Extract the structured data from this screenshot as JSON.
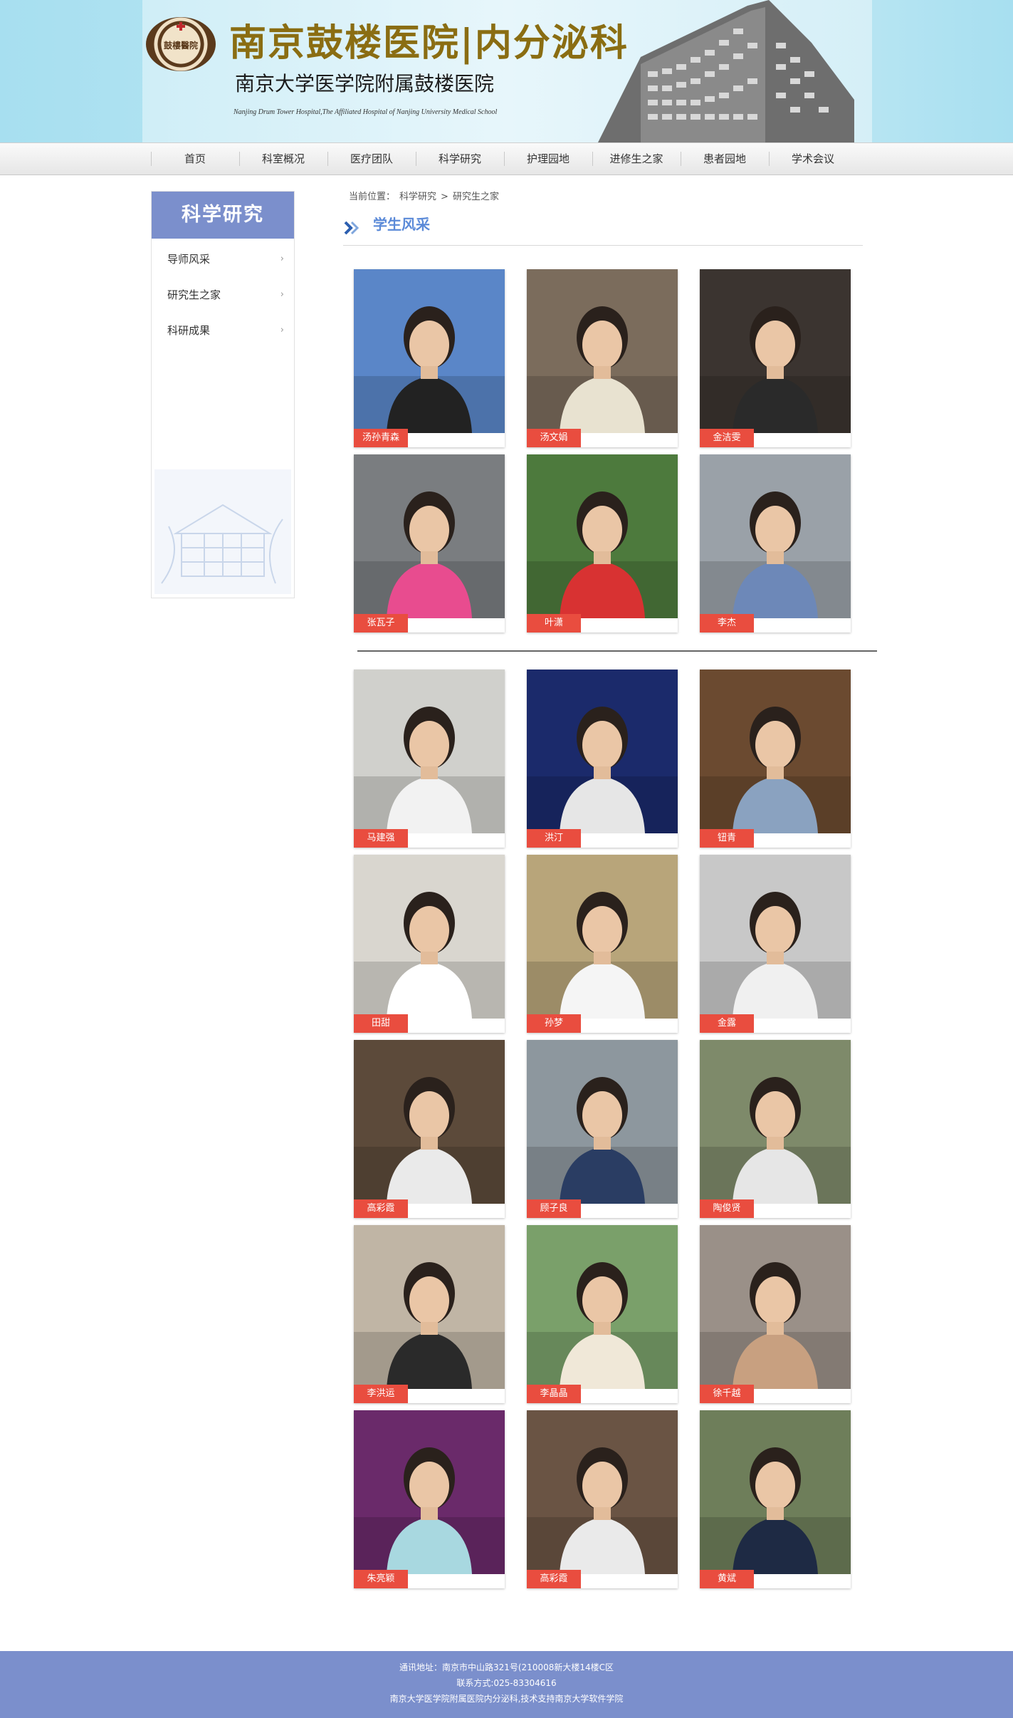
{
  "header": {
    "seal_text": "鼓樓醫院",
    "title": "南京鼓楼医院|内分泌科",
    "subtitle": "南京大学医学院附属鼓楼医院",
    "english": "Nanjing Drum Tower Hospital,The Affiliated Hospital of Nanjing University Medical School"
  },
  "nav": {
    "items": [
      "首页",
      "科室概况",
      "医疗团队",
      "科学研究",
      "护理园地",
      "进修生之家",
      "患者园地",
      "学术会议"
    ]
  },
  "sidebar": {
    "title": "科学研究",
    "items": [
      {
        "label": "导师风采",
        "arrow": "›"
      },
      {
        "label": "研究生之家",
        "arrow": "›"
      },
      {
        "label": "科研成果",
        "arrow": "›"
      }
    ]
  },
  "breadcrumb": {
    "prefix": "当前位置：",
    "level1": "科学研究",
    "sep": ">",
    "level2": "研究生之家"
  },
  "section": {
    "title": "学生风采"
  },
  "students": [
    {
      "name": "汤孙青森",
      "bg": "#5a86c8",
      "shirt": "#222222"
    },
    {
      "name": "汤文娟",
      "bg": "#7b6c5c",
      "shirt": "#e8e2d0"
    },
    {
      "name": "金洁雯",
      "bg": "#3b3430",
      "shirt": "#2a2a2a"
    },
    {
      "name": "张瓦子",
      "bg": "#7a7d80",
      "shirt": "#e84c8f"
    },
    {
      "name": "叶潇",
      "bg": "#4d7a3d",
      "shirt": "#d83232"
    },
    {
      "name": "李杰",
      "bg": "#9aa1a8",
      "shirt": "#6d88b8"
    },
    {
      "name": "马建强",
      "bg": "#d0d0cc",
      "shirt": "#f2f2f2"
    },
    {
      "name": "洪汀",
      "bg": "#1b2a6b",
      "shirt": "#e6e6e6"
    },
    {
      "name": "钮青",
      "bg": "#6b4a30",
      "shirt": "#8aa2c0"
    },
    {
      "name": "田甜",
      "bg": "#d9d6cf",
      "shirt": "#ffffff"
    },
    {
      "name": "孙梦",
      "bg": "#b8a57a",
      "shirt": "#f5f5f5"
    },
    {
      "name": "金露",
      "bg": "#c8c8c8",
      "shirt": "#f0f0f0"
    },
    {
      "name": "高彩霞",
      "bg": "#5c4a3a",
      "shirt": "#eaeaea"
    },
    {
      "name": "顾子良",
      "bg": "#8d979e",
      "shirt": "#2a3d63"
    },
    {
      "name": "陶俊贤",
      "bg": "#7e8a6a",
      "shirt": "#e6e6e6"
    },
    {
      "name": "李洪运",
      "bg": "#c0b5a5",
      "shirt": "#2a2a2a"
    },
    {
      "name": "李晶晶",
      "bg": "#7aa06a",
      "shirt": "#f0e8d8"
    },
    {
      "name": "徐千越",
      "bg": "#9a9088",
      "shirt": "#c8a080"
    },
    {
      "name": "朱亮颖",
      "bg": "#6a2a6a",
      "shirt": "#a8d8e0"
    },
    {
      "name": "高彩霞",
      "bg": "#6a5444",
      "shirt": "#eaeaea"
    },
    {
      "name": "黄斌",
      "bg": "#6e7e5a",
      "shirt": "#1e2a44"
    }
  ],
  "footer": {
    "address": "通讯地址：南京市中山路321号(210008新大楼14楼C区",
    "contact": "联系方式:025-83304616",
    "support": "南京大学医学院附属医院内分泌科,技术支持南京大学软件学院"
  }
}
